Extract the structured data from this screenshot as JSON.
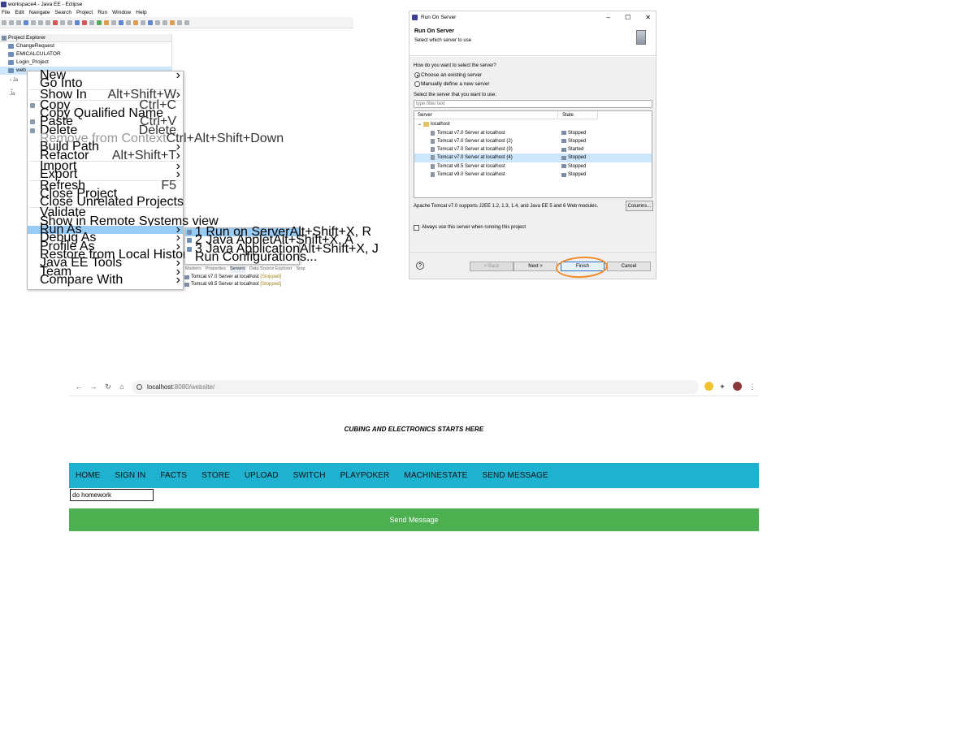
{
  "eclipse": {
    "window_title": "workspace4 - Java EE - Eclipse",
    "menu": [
      "File",
      "Edit",
      "Navigate",
      "Search",
      "Project",
      "Run",
      "Window",
      "Help"
    ],
    "project_explorer": {
      "title": "Project Explorer",
      "items": [
        "ChangeRequest",
        "EMICALCULATOR",
        "Login_Project",
        "web"
      ]
    },
    "context_menu": [
      {
        "label": "New",
        "shortcut": "",
        "submenu": true
      },
      {
        "label": "Go Into",
        "shortcut": ""
      },
      {
        "sep": true
      },
      {
        "label": "Show In",
        "shortcut": "Alt+Shift+W",
        "submenu": true
      },
      {
        "sep": true
      },
      {
        "label": "Copy",
        "shortcut": "Ctrl+C"
      },
      {
        "label": "Copy Qualified Name",
        "shortcut": ""
      },
      {
        "label": "Paste",
        "shortcut": "Ctrl+V"
      },
      {
        "label": "Delete",
        "shortcut": "Delete"
      },
      {
        "label": "Remove from Context",
        "shortcut": "Ctrl+Alt+Shift+Down",
        "disabled": true
      },
      {
        "label": "Build Path",
        "shortcut": "",
        "submenu": true
      },
      {
        "label": "Refactor",
        "shortcut": "Alt+Shift+T",
        "submenu": true
      },
      {
        "sep": true
      },
      {
        "label": "Import",
        "shortcut": "",
        "submenu": true
      },
      {
        "label": "Export",
        "shortcut": "",
        "submenu": true
      },
      {
        "sep": true
      },
      {
        "label": "Refresh",
        "shortcut": "F5"
      },
      {
        "label": "Close Project",
        "shortcut": ""
      },
      {
        "label": "Close Unrelated Projects",
        "shortcut": ""
      },
      {
        "sep": true
      },
      {
        "label": "Validate",
        "shortcut": ""
      },
      {
        "label": "Show in Remote Systems view",
        "shortcut": ""
      },
      {
        "label": "Run As",
        "shortcut": "",
        "submenu": true,
        "highlighted": true
      },
      {
        "label": "Debug As",
        "shortcut": "",
        "submenu": true
      },
      {
        "label": "Profile As",
        "shortcut": "",
        "submenu": true
      },
      {
        "label": "Restore from Local History...",
        "shortcut": ""
      },
      {
        "label": "Java EE Tools",
        "shortcut": "",
        "submenu": true
      },
      {
        "label": "Team",
        "shortcut": "",
        "submenu": true
      },
      {
        "label": "Compare With",
        "shortcut": "",
        "submenu": true
      }
    ],
    "run_as_submenu": [
      {
        "label": "1 Run on Server",
        "shortcut": "Alt+Shift+X, R",
        "highlighted": true
      },
      {
        "label": "2 Java Applet",
        "shortcut": "Alt+Shift+X, A"
      },
      {
        "label": "3 Java Application",
        "shortcut": "Alt+Shift+X, J"
      },
      {
        "label": "Run Configurations...",
        "shortcut": ""
      }
    ],
    "bottom_tabs": [
      "Markers",
      "Properties",
      "Servers",
      "Data Source Explorer",
      "Snip"
    ],
    "servers_list": [
      {
        "name": "Tomcat v7.0 Server at localhost",
        "state": "[Stopped]"
      },
      {
        "name": "Tomcat v8.5 Server at localhost",
        "state": "[Stopped]"
      }
    ]
  },
  "dialog": {
    "title": "Run On Server",
    "banner_title": "Run On Server",
    "banner_subtitle": "Select which server to use",
    "question": "How do you want to select the server?",
    "radio_existing": "Choose an existing server",
    "radio_manual": "Manually define a new server",
    "select_label": "Select the server that you want to use:",
    "filter_placeholder": "type filter text",
    "col_server": "Server",
    "col_state": "State",
    "host": "localhost",
    "servers": [
      {
        "name": "Tomcat v7.0 Server at localhost",
        "state": "Stopped"
      },
      {
        "name": "Tomcat v7.0 Server at localhost (2)",
        "state": "Stopped"
      },
      {
        "name": "Tomcat v7.0 Server at localhost (3)",
        "state": "Started"
      },
      {
        "name": "Tomcat v7.0 Server at localhost (4)",
        "state": "Stopped",
        "selected": true
      },
      {
        "name": "Tomcat v8.5 Server at localhost",
        "state": "Stopped"
      },
      {
        "name": "Tomcat v9.0 Server at localhost",
        "state": "Stopped"
      }
    ],
    "description": "Apache Tomcat v7.0 supports J2EE 1.2, 1.3, 1.4, and Java EE 5 and 6 Web modules.",
    "columns_btn": "Columns...",
    "always_use": "Always use this server when running this project",
    "btn_back": "< Back",
    "btn_next": "Next >",
    "btn_finish": "Finish",
    "btn_cancel": "Cancel",
    "help": "?",
    "accent_circle_color": "#f08a2a"
  },
  "browser": {
    "url_host": "localhost",
    "url_rest": ":8080/website/",
    "headline": "CUBING AND ELECTRONICS STARTS HERE",
    "nav": [
      "HOME",
      "SIGN IN",
      "FACTS",
      "STORE",
      "UPLOAD",
      "SWITCH",
      "PLAYPOKER",
      "MACHINESTATE",
      "SEND MESSAGE"
    ],
    "message_value": "do homework",
    "send_button": "Send Message",
    "navbar_color": "#1fb1d0",
    "button_color": "#4caf50"
  }
}
